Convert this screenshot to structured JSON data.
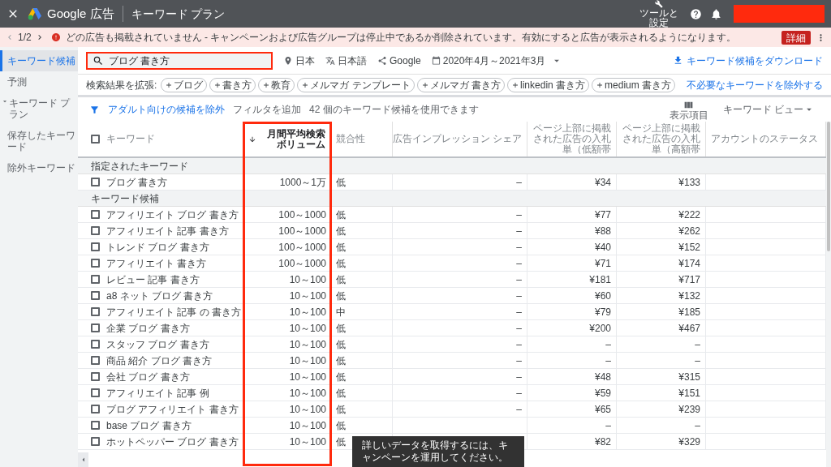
{
  "top_bar": {
    "brand": "Google 広告",
    "title": "キーワード プラン",
    "tools_label": [
      "ツールと",
      "設定"
    ]
  },
  "notice": {
    "pager": "1/2",
    "text": "どの広告も掲載されていません - キャンペーンおよび広告グループは停止中であるか削除されています。有効にすると広告が表示されるようになります。",
    "button": "詳細"
  },
  "sidebar": {
    "items": [
      {
        "label": "キーワード候補",
        "kind": "link",
        "selected": true
      },
      {
        "label": "予測",
        "kind": "link",
        "selected": false
      },
      {
        "label": "キーワード プラン",
        "kind": "group",
        "selected": false
      },
      {
        "label": "保存したキーワード",
        "kind": "link",
        "selected": false
      },
      {
        "label": "除外キーワード",
        "kind": "link",
        "selected": false
      }
    ]
  },
  "search": {
    "value": "ブログ 書き方"
  },
  "targeting": [
    {
      "kind": "location",
      "label": "日本"
    },
    {
      "kind": "language",
      "label": "日本語"
    },
    {
      "kind": "network",
      "label": "Google"
    },
    {
      "kind": "date",
      "label": "2020年4月～2021年3月"
    }
  ],
  "download": "キーワード候補をダウンロード",
  "expand": {
    "label": "検索結果を拡張:",
    "chips": [
      "ブログ",
      "書き方",
      "教育",
      "メルマガ テンプレート",
      "メルマガ 書き方",
      "linkedin 書き方",
      "medium 書き方"
    ],
    "exclude_link": "不必要なキーワードを除外する"
  },
  "filter": {
    "adult_filter": "アダルト向けの候補を除外",
    "add_filter": "フィルタを追加",
    "count_text": "42 個のキーワード候補を使用できます",
    "columns_label": "表示項目",
    "view": "キーワード ビュー"
  },
  "table": {
    "all_checked": false,
    "columns": [
      {
        "label": "キーワード",
        "sorted": false
      },
      {
        "label": "月間平均検索ボリューム",
        "sorted": true
      },
      {
        "label": "競合性",
        "sorted": false
      },
      {
        "label": "広告インプレッション シェア",
        "sorted": false
      },
      {
        "label": "ページ上部に掲載された広告の入札単（低額帯",
        "sorted": false
      },
      {
        "label": "ページ上部に掲載された広告の入札単（高額帯",
        "sorted": false
      },
      {
        "label": "アカウントのステータス",
        "sorted": false
      }
    ],
    "rows": [
      {
        "kind": "group",
        "label": "指定されたキーワード"
      },
      {
        "kind": "keyword",
        "checked": false,
        "cells": [
          "ブログ 書き方",
          "1000～1万",
          "低",
          "–",
          "¥34",
          "¥133"
        ]
      },
      {
        "kind": "group",
        "label": "キーワード候補"
      },
      {
        "kind": "keyword",
        "checked": false,
        "cells": [
          "アフィリエイト ブログ 書き方",
          "100～1000",
          "低",
          "–",
          "¥77",
          "¥222"
        ]
      },
      {
        "kind": "keyword",
        "checked": false,
        "cells": [
          "アフィリエイト 記事 書き方",
          "100～1000",
          "低",
          "–",
          "¥88",
          "¥262"
        ]
      },
      {
        "kind": "keyword",
        "checked": false,
        "cells": [
          "トレンド ブログ 書き方",
          "100～1000",
          "低",
          "–",
          "¥40",
          "¥152"
        ]
      },
      {
        "kind": "keyword",
        "checked": false,
        "cells": [
          "アフィリエイト 書き方",
          "100～1000",
          "低",
          "–",
          "¥71",
          "¥174"
        ]
      },
      {
        "kind": "keyword",
        "checked": false,
        "cells": [
          "レビュー 記事 書き方",
          "10～100",
          "低",
          "–",
          "¥181",
          "¥717"
        ]
      },
      {
        "kind": "keyword",
        "checked": false,
        "cells": [
          "a8 ネット ブログ 書き方",
          "10～100",
          "低",
          "–",
          "¥60",
          "¥132"
        ]
      },
      {
        "kind": "keyword",
        "checked": false,
        "cells": [
          "アフィリエイト 記事 の 書き方",
          "10～100",
          "中",
          "–",
          "¥79",
          "¥185"
        ]
      },
      {
        "kind": "keyword",
        "checked": false,
        "cells": [
          "企業 ブログ 書き方",
          "10～100",
          "低",
          "–",
          "¥200",
          "¥467"
        ]
      },
      {
        "kind": "keyword",
        "checked": false,
        "cells": [
          "スタッフ ブログ 書き方",
          "10～100",
          "低",
          "–",
          "–",
          "–"
        ]
      },
      {
        "kind": "keyword",
        "checked": false,
        "cells": [
          "商品 紹介 ブログ 書き方",
          "10～100",
          "低",
          "–",
          "–",
          "–"
        ]
      },
      {
        "kind": "keyword",
        "checked": false,
        "cells": [
          "会社 ブログ 書き方",
          "10～100",
          "低",
          "–",
          "¥48",
          "¥315"
        ]
      },
      {
        "kind": "keyword",
        "checked": false,
        "cells": [
          "アフィリエイト 記事 例",
          "10～100",
          "低",
          "–",
          "¥59",
          "¥151"
        ]
      },
      {
        "kind": "keyword",
        "checked": false,
        "cells": [
          "ブログ アフィリエイト 書き方",
          "10～100",
          "低",
          "–",
          "¥65",
          "¥239"
        ]
      },
      {
        "kind": "keyword",
        "checked": false,
        "cells": [
          "base ブログ 書き方",
          "10～100",
          "低",
          null,
          "–",
          "–"
        ]
      },
      {
        "kind": "keyword",
        "checked": false,
        "cells": [
          "ホットペッパー ブログ 書き方",
          "10～100",
          "低",
          null,
          "¥82",
          "¥329"
        ]
      }
    ]
  },
  "toast": "詳しいデータを取得するには、キャンペーンを運用してください。"
}
